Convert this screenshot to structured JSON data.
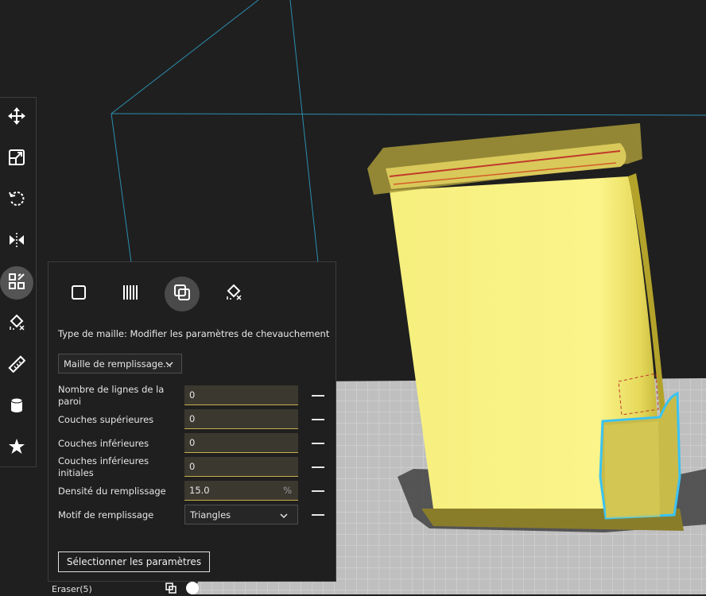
{
  "toolbar": {
    "tools": [
      {
        "name": "move-tool",
        "icon": "move-icon"
      },
      {
        "name": "scale-tool",
        "icon": "scale-icon"
      },
      {
        "name": "rotate-tool",
        "icon": "rotate-icon"
      },
      {
        "name": "mirror-tool",
        "icon": "mirror-icon"
      },
      {
        "name": "per-model-settings-tool",
        "icon": "per-model-settings-icon",
        "active": true
      },
      {
        "name": "support-blocker-tool",
        "icon": "support-blocker-icon"
      },
      {
        "name": "measure-tool",
        "icon": "ruler-icon"
      },
      {
        "name": "cylinder-tool",
        "icon": "cylinder-icon"
      },
      {
        "name": "support-tool",
        "icon": "star-icon"
      }
    ]
  },
  "panel": {
    "mesh_types": [
      {
        "name": "normal-model",
        "icon": "square-icon"
      },
      {
        "name": "infill-mesh",
        "icon": "infill-lines-icon"
      },
      {
        "name": "overlap-mesh",
        "icon": "overlap-icon",
        "active": true
      },
      {
        "name": "anti-overhang-mesh",
        "icon": "support-blocker-icon"
      }
    ],
    "mesh_type_label": "Type de maille: Modifier les paramètres de chevauchement",
    "mesh_dropdown": "Maille de remplissage...",
    "settings": [
      {
        "label": "Nombre de lignes de la paroi",
        "value": "0"
      },
      {
        "label": "Couches supérieures",
        "value": "0"
      },
      {
        "label": "Couches inférieures",
        "value": "0"
      },
      {
        "label": "Couches inférieures initiales",
        "value": "0"
      },
      {
        "label": "Densité du remplissage",
        "value": "15.0",
        "unit": "%"
      },
      {
        "label": "Motif de remplissage",
        "value": "Triangles",
        "select": true
      }
    ],
    "select_settings_button": "Sélectionner les paramètres"
  },
  "status": {
    "label": "Eraser(5)"
  },
  "colors": {
    "background": "#1f1f1f",
    "model_yellow": "#f5ee7a",
    "selection_outline": "#3ac3f2",
    "build_plate": "#bdbdbd",
    "field_accent": "#c8b04a"
  }
}
